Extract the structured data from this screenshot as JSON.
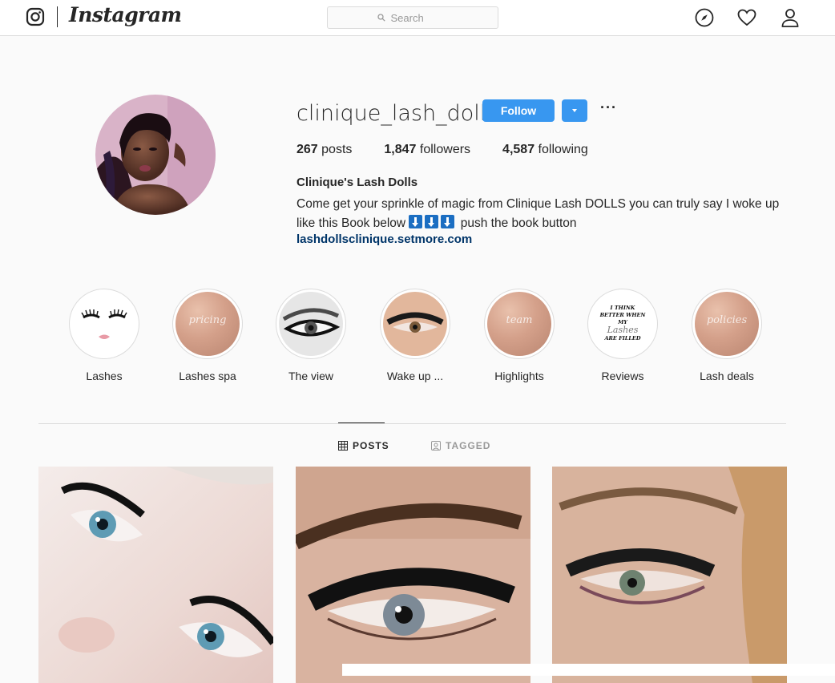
{
  "nav": {
    "wordmark": "Instagram",
    "search_placeholder": "Search",
    "icons": [
      "instagram-glyph-icon",
      "explore-compass-icon",
      "activity-heart-icon",
      "profile-person-icon"
    ]
  },
  "profile": {
    "username": "clinique_lash_dolls",
    "follow_label": "Follow",
    "more_label": "···",
    "stats": {
      "posts_count": "267",
      "posts_label": "posts",
      "followers_count": "1,847",
      "followers_label": "followers",
      "following_count": "4,587",
      "following_label": "following"
    },
    "full_name": "Clinique's Lash Dolls",
    "bio_line1": "Come get your sprinkle of magic from Clinique Lash DOLLS you can truly say I woke up",
    "bio_line2_before": "like this Book below",
    "bio_line2_after": "push the book button",
    "website": "lashdollsclinique.setmore.com"
  },
  "highlights": [
    {
      "label": "Lashes",
      "cover": "lashes-face"
    },
    {
      "label": "Lashes spa",
      "cover": "rose-gold",
      "cover_text": "pricing"
    },
    {
      "label": "The view",
      "cover": "eye-closeup-bw"
    },
    {
      "label": "Wake up ...",
      "cover": "eye-closeup-color"
    },
    {
      "label": "Highlights",
      "cover": "rose-gold",
      "cover_text": "team"
    },
    {
      "label": "Reviews",
      "cover": "quote",
      "cover_text_1": "I THINK",
      "cover_text_2": "BETTER WHEN MY",
      "cover_text_3": "Lashes",
      "cover_text_4": "ARE FILLED"
    },
    {
      "label": "Lash deals",
      "cover": "rose-gold",
      "cover_text": "policies"
    }
  ],
  "tabs": [
    {
      "label": "POSTS",
      "active": true
    },
    {
      "label": "TAGGED",
      "active": false
    }
  ],
  "colors": {
    "accent": "#3897f0",
    "link": "#003569",
    "text": "#262626",
    "border": "#dbdbdb",
    "background": "#fafafa"
  }
}
